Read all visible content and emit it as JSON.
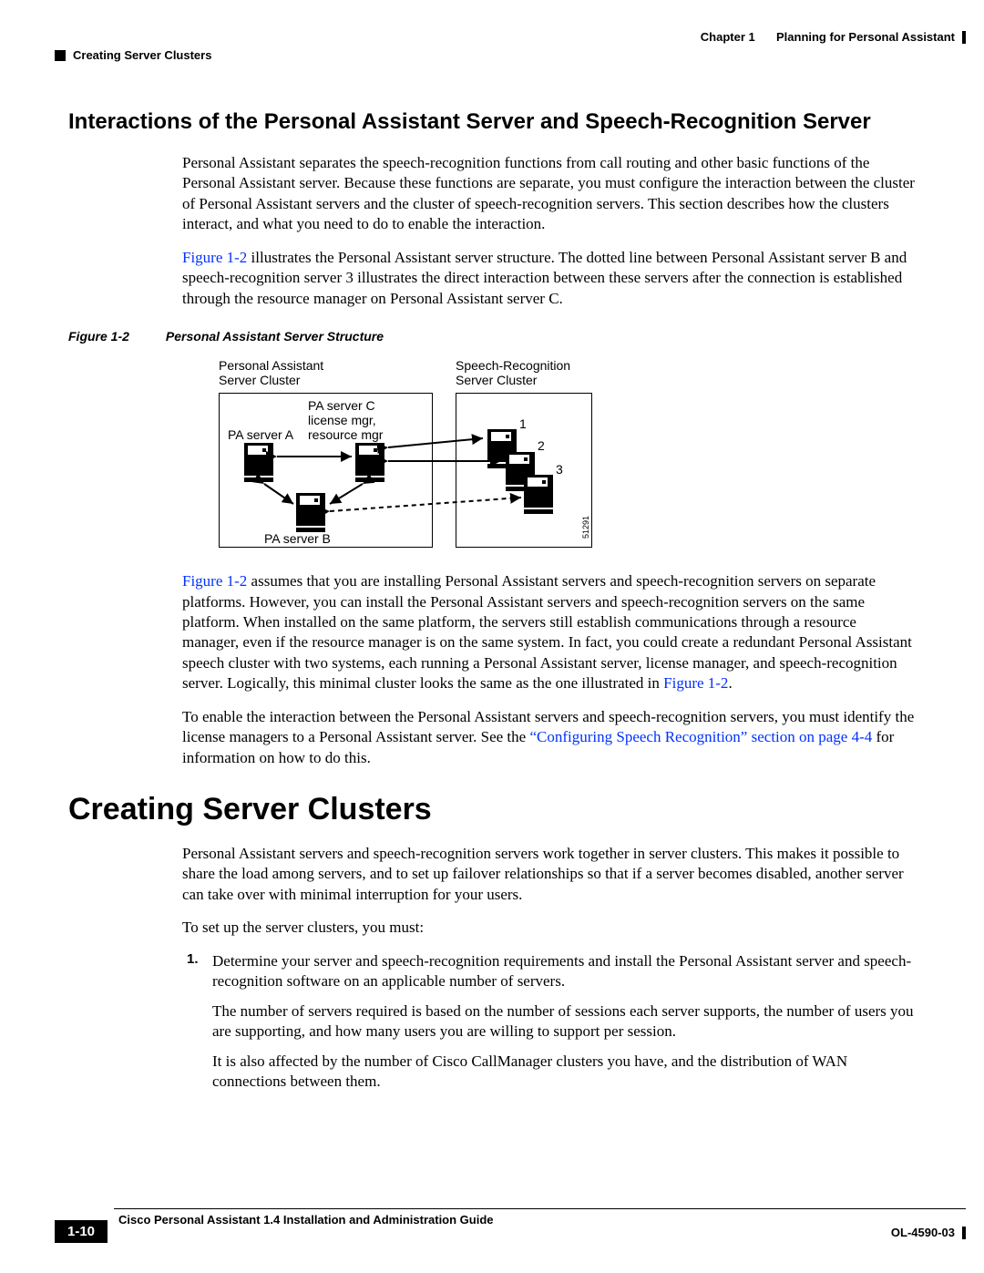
{
  "header": {
    "chapter": "Chapter 1",
    "chapter_title": "Planning for Personal Assistant",
    "section": "Creating Server Clusters"
  },
  "h_section1": "Interactions of the Personal Assistant Server and Speech-Recognition Server",
  "p1": "Personal Assistant separates the speech-recognition functions from call routing and other basic functions of the Personal Assistant server. Because these functions are separate, you must configure the interaction between the cluster of Personal Assistant servers and the cluster of speech-recognition servers. This section describes how the clusters interact, and what you need to do to enable the interaction.",
  "p2a": "Figure 1-2",
  "p2b": " illustrates the Personal Assistant server structure. The dotted line between Personal Assistant server B and speech-recognition server 3 illustrates the direct interaction between these servers after the connection is established through the resource manager on Personal Assistant server C.",
  "figure": {
    "num": "Figure 1-2",
    "title": "Personal Assistant Server Structure",
    "labels": {
      "pa_cluster": "Personal Assistant Server Cluster",
      "sr_cluster": "Speech-Recognition Server Cluster",
      "pa_a": "PA server A",
      "pa_b": "PA server B",
      "pa_c_l1": "PA server C",
      "pa_c_l2": "license mgr,",
      "pa_c_l3": "resource mgr",
      "n1": "1",
      "n2": "2",
      "n3": "3",
      "side": "51291"
    }
  },
  "p3a": "Figure 1-2",
  "p3b": " assumes that you are installing Personal Assistant servers and speech-recognition servers on separate platforms. However, you can install the Personal Assistant servers and speech-recognition servers on the same platform. When installed on the same platform, the servers still establish communications through a resource manager, even if the resource manager is on the same system. In fact, you could create a redundant Personal Assistant speech cluster with two systems, each running a Personal Assistant server, license manager, and speech-recognition server. Logically, this minimal cluster looks the same as the one illustrated in ",
  "p3c": "Figure 1-2",
  "p3d": ".",
  "p4a": "To enable the interaction between the Personal Assistant servers and speech-recognition servers, you must identify the license managers to a Personal Assistant server. See the ",
  "p4b": "“Configuring Speech Recognition” section on page 4-4",
  "p4c": " for information on how to do this.",
  "h_section2": "Creating Server Clusters",
  "p5": "Personal Assistant servers and speech-recognition servers work together in server clusters. This makes it possible to share the load among servers, and to set up failover relationships so that if a server becomes disabled, another server can take over with minimal interruption for your users.",
  "p6": "To set up the server clusters, you must:",
  "list": {
    "n1": "1.",
    "i1": "Determine your server and speech-recognition requirements and install the Personal Assistant server and speech-recognition software on an applicable number of servers.",
    "i1b": "The number of servers required is based on the number of sessions each server supports, the number of users you are supporting, and how many users you are willing to support per session.",
    "i1c": "It is also affected by the number of Cisco CallManager clusters you have, and the distribution of WAN connections between them."
  },
  "footer": {
    "doc_title": "Cisco Personal Assistant 1.4 Installation and Administration Guide",
    "page": "1-10",
    "code": "OL-4590-03"
  }
}
